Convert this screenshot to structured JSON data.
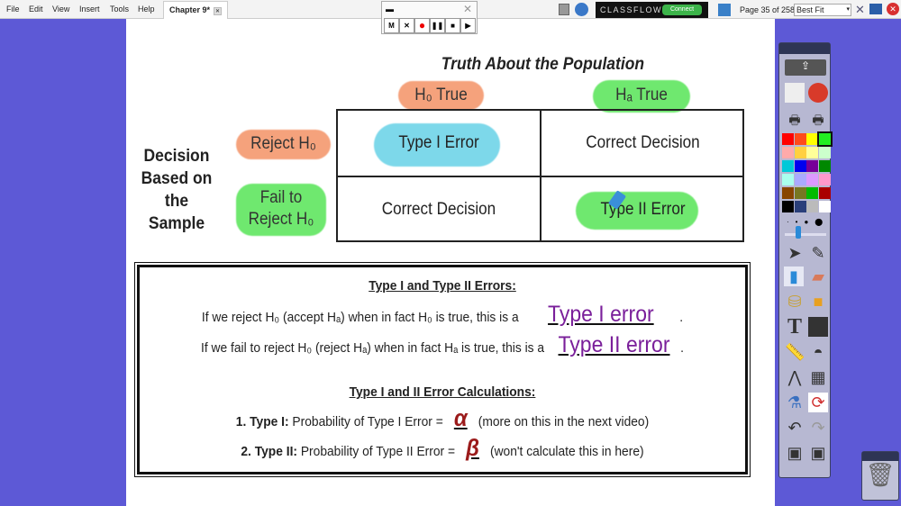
{
  "menu": [
    "File",
    "Edit",
    "View",
    "Insert",
    "Tools",
    "Help"
  ],
  "tab": {
    "title": "Chapter 9*"
  },
  "recorder": {
    "buttons": [
      "M",
      "✕",
      "●",
      "❚❚",
      "■",
      "▶"
    ]
  },
  "classflow": {
    "brand": "CLASSFLOW",
    "connect": "Connect"
  },
  "page_indicator": "Page 35 of 258",
  "zoom_select": "Best Fit",
  "slide": {
    "top_title": "Truth About the Population",
    "col_h0": "H₀ True",
    "col_ha": "Hₐ True",
    "row_label": "Decision Based on the Sample",
    "row_reject": "Reject H₀",
    "row_fail": "Fail to Reject H₀",
    "cells": [
      "Type I Error",
      "Correct Decision",
      "Correct Decision",
      "Type II Error"
    ],
    "box": {
      "heading1": "Type I and Type II Errors:",
      "line1": "If we reject H₀ (accept Hₐ) when in fact H₀ is true, this is a",
      "answer1": "Type I error",
      "line2": "If we fail to reject H₀ (reject Hₐ) when in fact Hₐ is true, this is a",
      "answer2": "Type II error",
      "heading2": "Type I and II Error Calculations:",
      "item1_label": "1.  Type I:",
      "item1_text": "Probability of Type I Error =",
      "item1_answer": "α",
      "item1_note": "(more on this in the next video)",
      "item2_label": "2.  Type II:",
      "item2_text": "Probability of Type II Error =",
      "item2_answer": "β",
      "item2_note": "(won't calculate this in here)"
    }
  },
  "colors": {
    "orange_highlight": "#f5a27c",
    "green_highlight": "#6fe86f",
    "cyan_highlight": "#7dd8ea",
    "answer_purple": "#7a1f9a",
    "greek_red": "#9b1b1b",
    "background": "#5d59d6"
  },
  "palette": [
    "#ff0000",
    "#ff4a1a",
    "#ffff00",
    "#22ee22",
    "#ffaaaa",
    "#ffd040",
    "#ffff99",
    "#ccffcc",
    "#00c8d8",
    "#0000ee",
    "#770099",
    "#008800",
    "#aaffee",
    "#aaaaff",
    "#dd99ff",
    "#ff99cc",
    "#884400",
    "#777722",
    "#00bb00",
    "#aa0000",
    "#000000",
    "#2a3f7a",
    "#bbbbbb",
    "#ffffff"
  ]
}
